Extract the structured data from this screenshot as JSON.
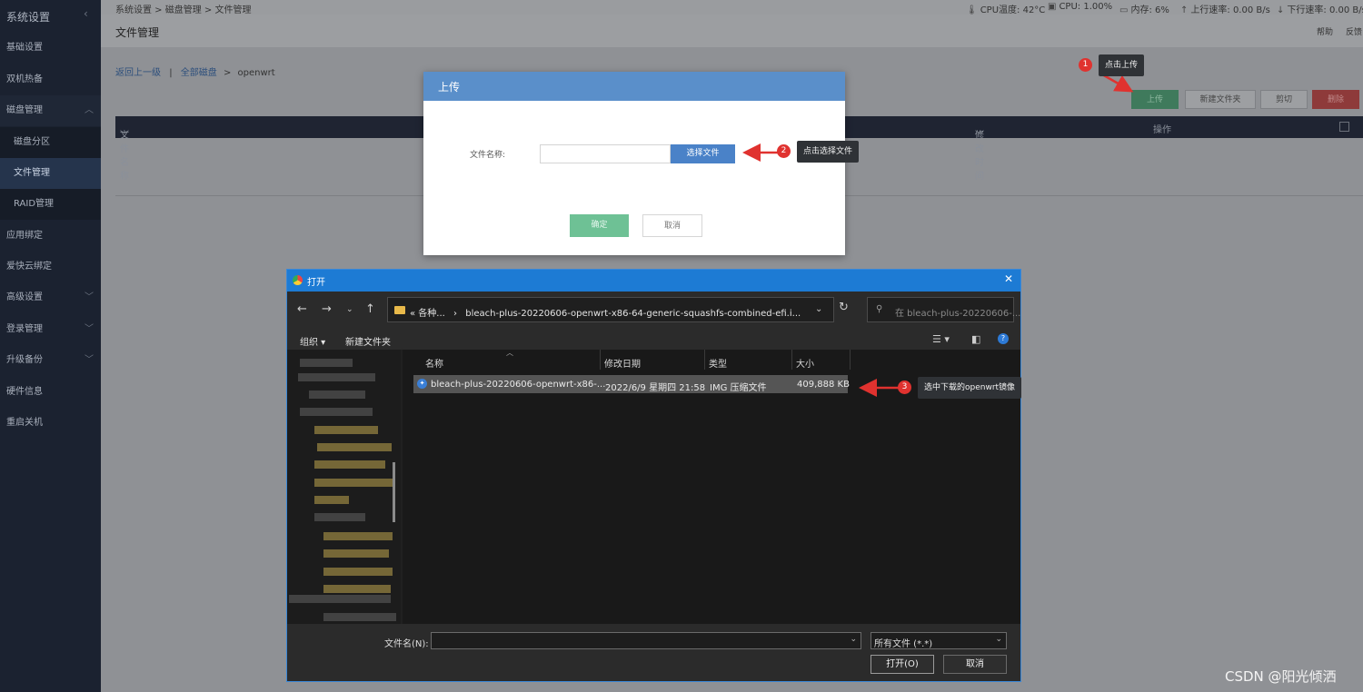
{
  "sidebar": {
    "title": "系统设置",
    "items": [
      {
        "label": "基础设置"
      },
      {
        "label": "双机热备"
      },
      {
        "label": "磁盘管理"
      },
      {
        "label": "磁盘分区"
      },
      {
        "label": "文件管理"
      },
      {
        "label": "RAID管理"
      },
      {
        "label": "应用绑定"
      },
      {
        "label": "爱快云绑定"
      },
      {
        "label": "高级设置"
      },
      {
        "label": "登录管理"
      },
      {
        "label": "升级备份"
      },
      {
        "label": "硬件信息"
      },
      {
        "label": "重启关机"
      }
    ]
  },
  "topbar": {
    "breadcrumb": "系统设置 > 磁盘管理 > 文件管理",
    "cpu_temp": "CPU温度: 42°C",
    "cpu": "CPU: 1.00%",
    "memory": "内存: 6%",
    "up_speed": "上行速率: 0.00 B/s",
    "down_speed": "下行速率: 0.00 B/s"
  },
  "page": {
    "title": "文件管理",
    "help": "帮助",
    "feedback": "反馈",
    "back": "返回上一级",
    "sep": "|",
    "all_disks": "全部磁盘",
    "arrow": ">",
    "current": "openwrt",
    "buttons": {
      "upload": "上传",
      "new_folder": "新建文件夹",
      "cut": "剪切",
      "delete": "删除"
    },
    "columns": {
      "name": "文件名称",
      "modified": "修改时间",
      "action": "操作"
    }
  },
  "upload_modal": {
    "title": "上传",
    "file_label": "文件名称:",
    "choose": "选择文件",
    "ok": "确定",
    "cancel": "取消"
  },
  "callouts": [
    {
      "num": "1",
      "text": "点击上传"
    },
    {
      "num": "2",
      "text": "点击选择文件"
    },
    {
      "num": "3",
      "text": "选中下载的openwrt镜像"
    }
  ],
  "dialog": {
    "title": "打开",
    "address_prefix": "« 各种...",
    "address_path": "bleach-plus-20220606-openwrt-x86-64-generic-squashfs-combined-efi.i...",
    "search_placeholder": "在 bleach-plus-20220606-...",
    "organize": "组织 ▾",
    "new_folder": "新建文件夹",
    "columns": {
      "name": "名称",
      "date": "修改日期",
      "type": "类型",
      "size": "大小"
    },
    "file": {
      "name": "bleach-plus-20220606-openwrt-x86-...",
      "date": "2022/6/9 星期四 21:58",
      "type": "IMG 压缩文件",
      "size": "409,888 KB"
    },
    "filename_label": "文件名(N):",
    "filetype": "所有文件 (*.*)",
    "open": "打开(O)",
    "cancel": "取消"
  },
  "watermark": "CSDN @阳光倾洒",
  "colors": {
    "accent": "#5a8fca",
    "upload_green": "#6ec195",
    "delete_red": "#e0322f",
    "dialog_blue": "#1d7bd4"
  }
}
